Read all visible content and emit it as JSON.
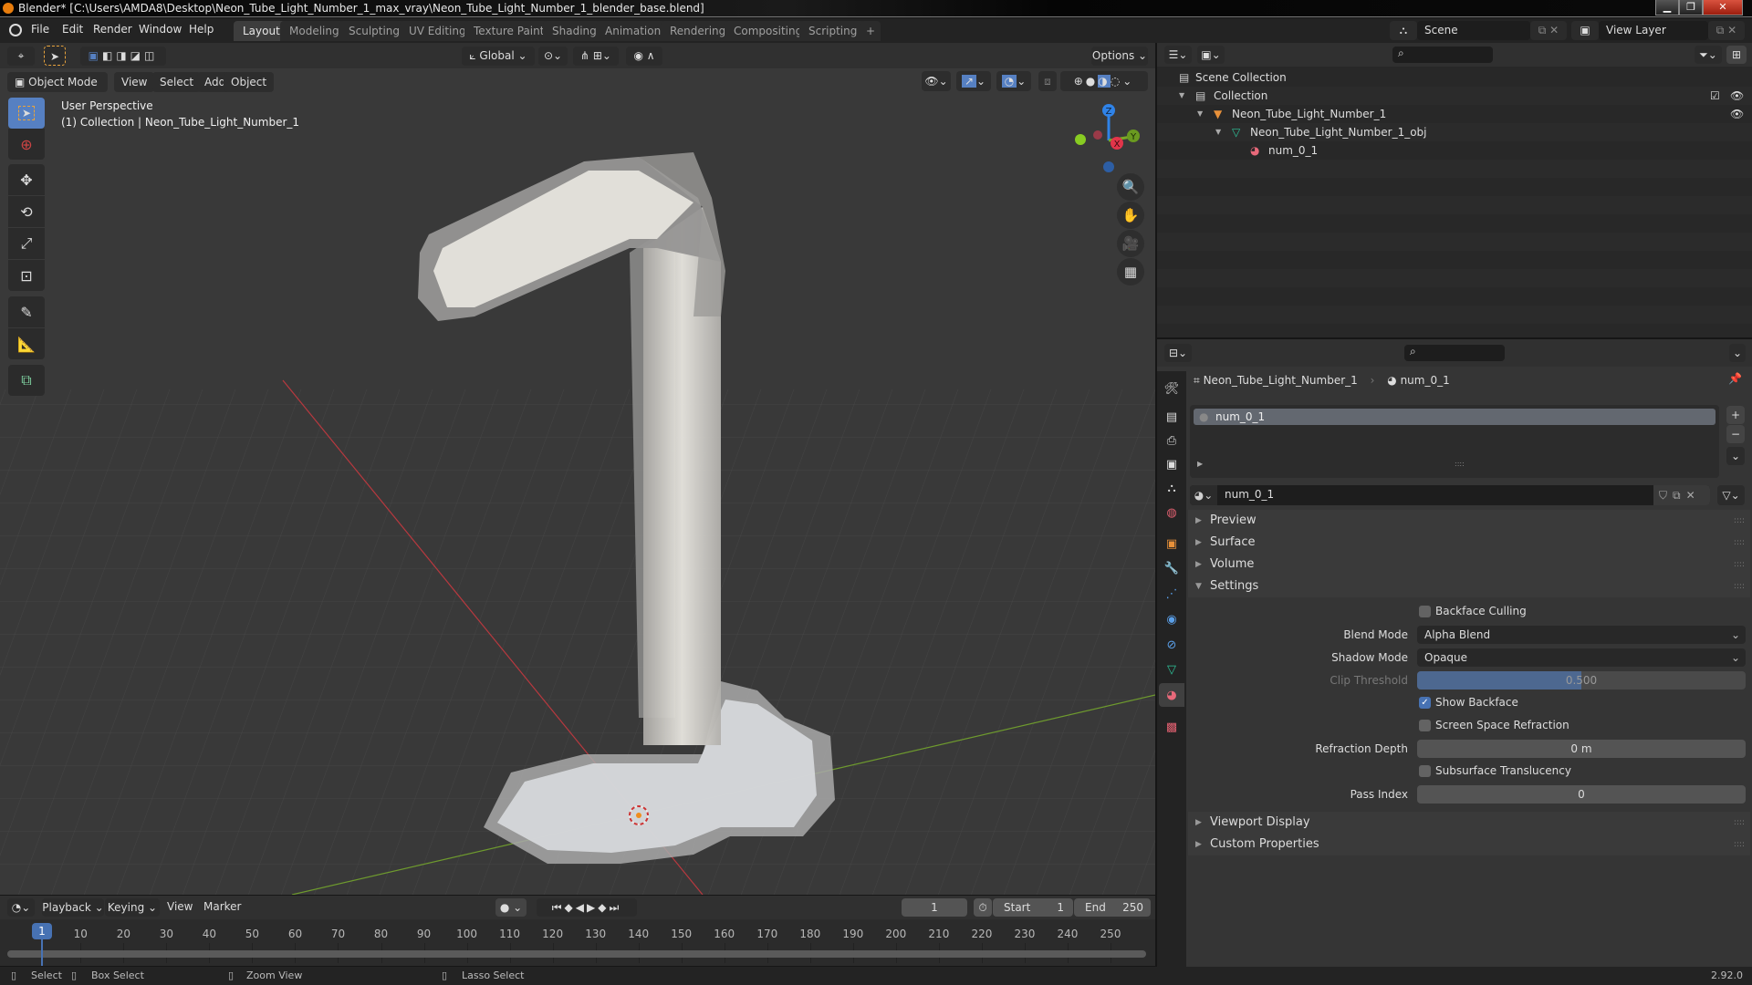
{
  "window": {
    "title": "Blender* [C:\\Users\\AMDA8\\Desktop\\Neon_Tube_Light_Number_1_max_vray\\Neon_Tube_Light_Number_1_blender_base.blend]",
    "minimize": "▁",
    "maximize": "❐",
    "close": "✕"
  },
  "menubar": {
    "items": [
      "File",
      "Edit",
      "Render",
      "Window",
      "Help"
    ],
    "workspaces": [
      "Layout",
      "Modeling",
      "Sculpting",
      "UV Editing",
      "Texture Paint",
      "Shading",
      "Animation",
      "Rendering",
      "Compositing",
      "Scripting"
    ],
    "active_workspace": "Layout",
    "add_workspace": "+",
    "scene": "Scene",
    "view_layer": "View Layer"
  },
  "viewport": {
    "transform_orientation": "Global",
    "options_label": "Options",
    "mode": "Object Mode",
    "menus": [
      "View",
      "Select",
      "Add",
      "Object"
    ],
    "overlay_title": "User Perspective",
    "overlay_subtitle": "(1) Collection | Neon_Tube_Light_Number_1",
    "gizmo": {
      "x": "X",
      "y": "Y",
      "z": "Z"
    },
    "colors": {
      "x_axis": "#e2354a",
      "y_axis": "#89c724",
      "z_axis": "#2f83e8",
      "background": "#393939",
      "object": "#e4e2dc"
    }
  },
  "outliner": {
    "rows": [
      {
        "label": "Scene Collection",
        "icon": "scene-collection-icon"
      },
      {
        "label": "Collection",
        "icon": "collection-icon"
      },
      {
        "label": "Neon_Tube_Light_Number_1",
        "icon": "object-icon"
      },
      {
        "label": "Neon_Tube_Light_Number_1_obj",
        "icon": "mesh-data-icon"
      },
      {
        "label": "num_0_1",
        "icon": "material-icon"
      }
    ]
  },
  "properties": {
    "breadcrumb_object": "Neon_Tube_Light_Number_1",
    "breadcrumb_material": "num_0_1",
    "slot_name": "num_0_1",
    "material_name": "num_0_1",
    "panels": {
      "preview": "Preview",
      "surface": "Surface",
      "volume": "Volume",
      "settings": "Settings",
      "viewport_display": "Viewport Display",
      "custom_properties": "Custom Properties"
    },
    "settings": {
      "backface_culling_label": "Backface Culling",
      "backface_culling": false,
      "blend_mode_label": "Blend Mode",
      "blend_mode": "Alpha Blend",
      "shadow_mode_label": "Shadow Mode",
      "shadow_mode": "Opaque",
      "clip_threshold_label": "Clip Threshold",
      "clip_threshold": "0.500",
      "clip_threshold_fraction": 0.5,
      "show_backface_label": "Show Backface",
      "show_backface": true,
      "ssr_label": "Screen Space Refraction",
      "ssr": false,
      "refraction_depth_label": "Refraction Depth",
      "refraction_depth": "0 m",
      "subsurface_label": "Subsurface Translucency",
      "subsurface": false,
      "pass_index_label": "Pass Index",
      "pass_index": "0"
    }
  },
  "timeline": {
    "menus": [
      "Playback",
      "Keying",
      "View",
      "Marker"
    ],
    "current_frame": "1",
    "start_label": "Start",
    "start": "1",
    "end_label": "End",
    "end": "250",
    "ticks": [
      "10",
      "20",
      "30",
      "40",
      "50",
      "60",
      "70",
      "80",
      "90",
      "100",
      "110",
      "120",
      "130",
      "140",
      "150",
      "160",
      "170",
      "180",
      "190",
      "200",
      "210",
      "220",
      "230",
      "240",
      "250"
    ],
    "playhead": "1"
  },
  "statusbar": {
    "select": "Select",
    "box_select": "Box Select",
    "zoom_view": "Zoom View",
    "lasso_select": "Lasso Select",
    "version": "2.92.0"
  }
}
